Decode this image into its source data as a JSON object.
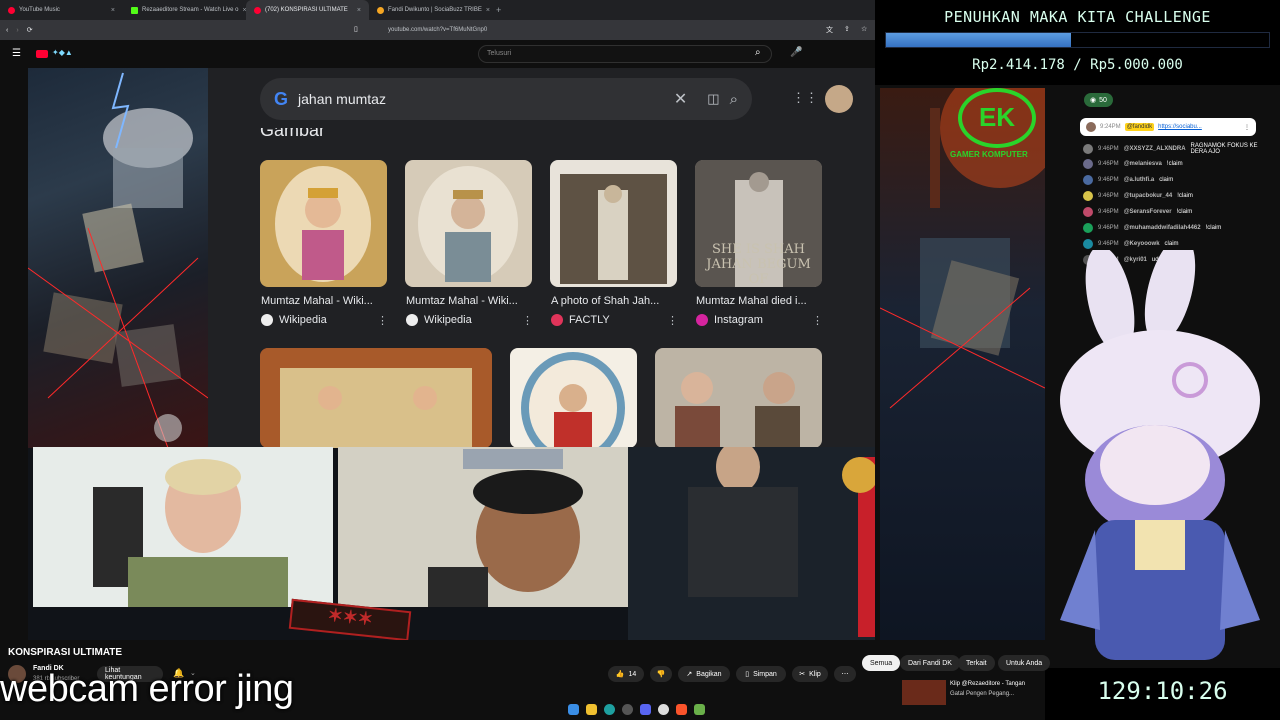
{
  "browser": {
    "tabs": [
      {
        "label": "YouTube Music",
        "color": "#ff0033"
      },
      {
        "label": "Rezaaeditore Stream - Watch Live o",
        "color": "#53fc18"
      },
      {
        "label": "(702) KONSPIRASI ULTIMATE",
        "color": "#ff0033"
      },
      {
        "label": "Fandi Dwikunto | SociaBuzz TRIBE",
        "color": "#f5a623"
      }
    ],
    "url": "youtube.com/watch?v=Tf6MuNtGnp0"
  },
  "youtube": {
    "search_placeholder": "Telusuri",
    "video_title": "KONSPIRASI ULTIMATE",
    "channel_name": "Fandi DK",
    "subscriber_count": "381 rb subscriber",
    "join_label": "Lihat keuntungan",
    "like_count": "14",
    "share_label": "Bagikan",
    "save_label": "Simpan",
    "clip_label": "Klip",
    "filters": [
      "Semua",
      "Dari Fandi DK",
      "Terkait",
      "Untuk Anda"
    ],
    "related_title": "Klip @Rezaeditore - Tangan",
    "related_sub": "Gatal Pengen Pegang..."
  },
  "google": {
    "query": "jahan mumtaz",
    "section_title": "Gambar",
    "results": [
      {
        "label": "Mumtaz Mahal - Wiki...",
        "source": "Wikipedia",
        "color": "#c9a35a"
      },
      {
        "label": "Mumtaz Mahal - Wiki...",
        "source": "Wikipedia",
        "color": "#b5a58a"
      },
      {
        "label": "A photo of Shah Jah...",
        "source": "FACTLY",
        "color": "#7a6a55"
      },
      {
        "label": "Mumtaz Mahal died i...",
        "source": "Instagram",
        "color": "#8a8580"
      }
    ],
    "image_text": "SHE IS SHAH JAHAN BEGUM OF"
  },
  "challenge": {
    "title": "PENUHKAN MAKA KITA CHALLENGE",
    "amount": "Rp2.414.178 / Rp5.000.000",
    "progress": 0.483
  },
  "chat": {
    "viewer_count": "50",
    "pinned_name": "@fandidk",
    "pinned_link": "https://sociabu...",
    "pinned_time": "9:24PM",
    "messages": [
      {
        "time": "9:46PM",
        "name": "@XXSYZZ_ALXNDRA",
        "msg": "RAGNAMOK FOKUS KE DERA AJO",
        "color": "#7a7a7a"
      },
      {
        "time": "9:46PM",
        "name": "@melaniesva",
        "msg": "!claim",
        "color": "#6a6a8a"
      },
      {
        "time": "9:46PM",
        "name": "@a.luthfi.a",
        "msg": "claim",
        "color": "#4a6aa0"
      },
      {
        "time": "9:46PM",
        "name": "@tupacbokur_44",
        "msg": "!claim",
        "color": "#d8c44a"
      },
      {
        "time": "9:46PM",
        "name": "@SeransForever",
        "msg": "!claim",
        "color": "#c04a6a"
      },
      {
        "time": "9:46PM",
        "name": "@muhamaddwifadilah4462",
        "msg": "!claim",
        "color": "#1aa05a"
      },
      {
        "time": "9:46PM",
        "name": "@Keyooowk",
        "msg": "claim",
        "color": "#1a8aa0"
      },
      {
        "time": "9:46PM",
        "name": "@kyri01",
        "msg": "udah abis",
        "color": "#555"
      }
    ]
  },
  "overlay": {
    "caption": "webcam error jing",
    "timer": "129:10:26",
    "logo_text": "EK",
    "logo_caption": "GAMER KOMPUTER"
  }
}
